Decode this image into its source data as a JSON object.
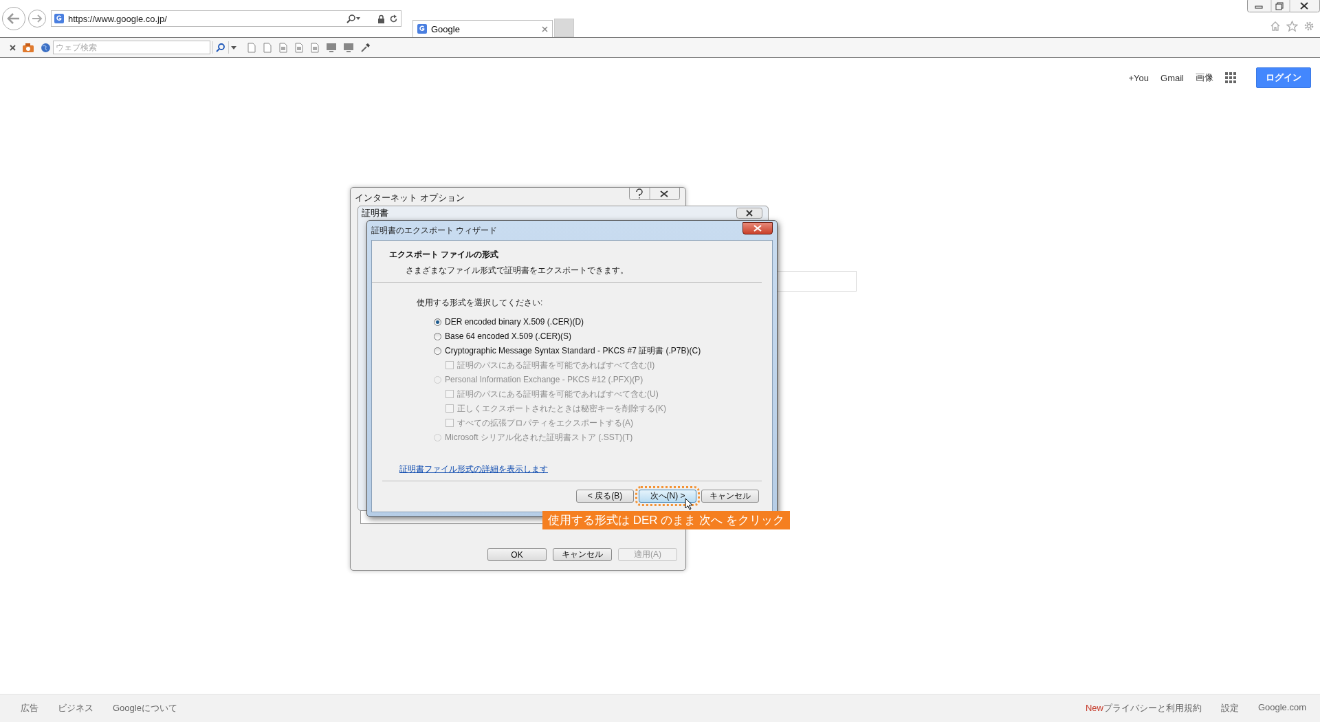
{
  "browser": {
    "address": "https://www.google.co.jp/",
    "tab_title": "Google",
    "search_placeholder": "ウェブ検索"
  },
  "google_header": {
    "links": [
      "+You",
      "Gmail",
      "画像"
    ],
    "login": "ログイン"
  },
  "internet_options": {
    "title": "インターネット オプション",
    "buttons": [
      {
        "label": "OK",
        "disabled": false
      },
      {
        "label": "キャンセル",
        "disabled": false
      },
      {
        "label": "適用(A)",
        "disabled": true
      }
    ]
  },
  "certificate_window": {
    "title": "証明書"
  },
  "wizard": {
    "title": "証明書のエクスポート ウィザード",
    "heading": "エクスポート ファイルの形式",
    "subtitle": "さまざまなファイル形式で証明書をエクスポートできます。",
    "prompt": "使用する形式を選択してください:",
    "options": [
      {
        "kind": "radio",
        "label": "DER encoded binary X.509 (.CER)(D)",
        "selected": true,
        "disabled": false
      },
      {
        "kind": "radio",
        "label": "Base 64 encoded X.509 (.CER)(S)",
        "selected": false,
        "disabled": false
      },
      {
        "kind": "radio",
        "label": "Cryptographic Message Syntax Standard - PKCS #7 証明書 (.P7B)(C)",
        "selected": false,
        "disabled": false
      },
      {
        "kind": "checkbox",
        "label": "証明のパスにある証明書を可能であればすべて含む(I)",
        "checked": false,
        "disabled": true
      },
      {
        "kind": "radio",
        "label": "Personal Information Exchange - PKCS #12 (.PFX)(P)",
        "selected": false,
        "disabled": true
      },
      {
        "kind": "checkbox",
        "label": "証明のパスにある証明書を可能であればすべて含む(U)",
        "checked": false,
        "disabled": true
      },
      {
        "kind": "checkbox",
        "label": "正しくエクスポートされたときは秘密キーを削除する(K)",
        "checked": false,
        "disabled": true
      },
      {
        "kind": "checkbox",
        "label": "すべての拡張プロパティをエクスポートする(A)",
        "checked": false,
        "disabled": true
      },
      {
        "kind": "radio",
        "label": "Microsoft シリアル化された証明書ストア (.SST)(T)",
        "selected": false,
        "disabled": true
      }
    ],
    "link": "証明書ファイル形式の詳細を表示します",
    "buttons": [
      {
        "label": "< 戻る(B)",
        "focused": false
      },
      {
        "label": "次へ(N) >",
        "focused": true
      },
      {
        "label": "キャンセル",
        "focused": false
      }
    ]
  },
  "annotation": "使用する形式は DER のまま 次へ をクリック",
  "footer": {
    "left": [
      "広告",
      "ビジネス",
      "Googleについて"
    ],
    "right": [
      {
        "badge": "New",
        "label": "プライバシーと利用規約"
      },
      {
        "label": "設定"
      },
      {
        "label": "Google.com"
      }
    ]
  }
}
